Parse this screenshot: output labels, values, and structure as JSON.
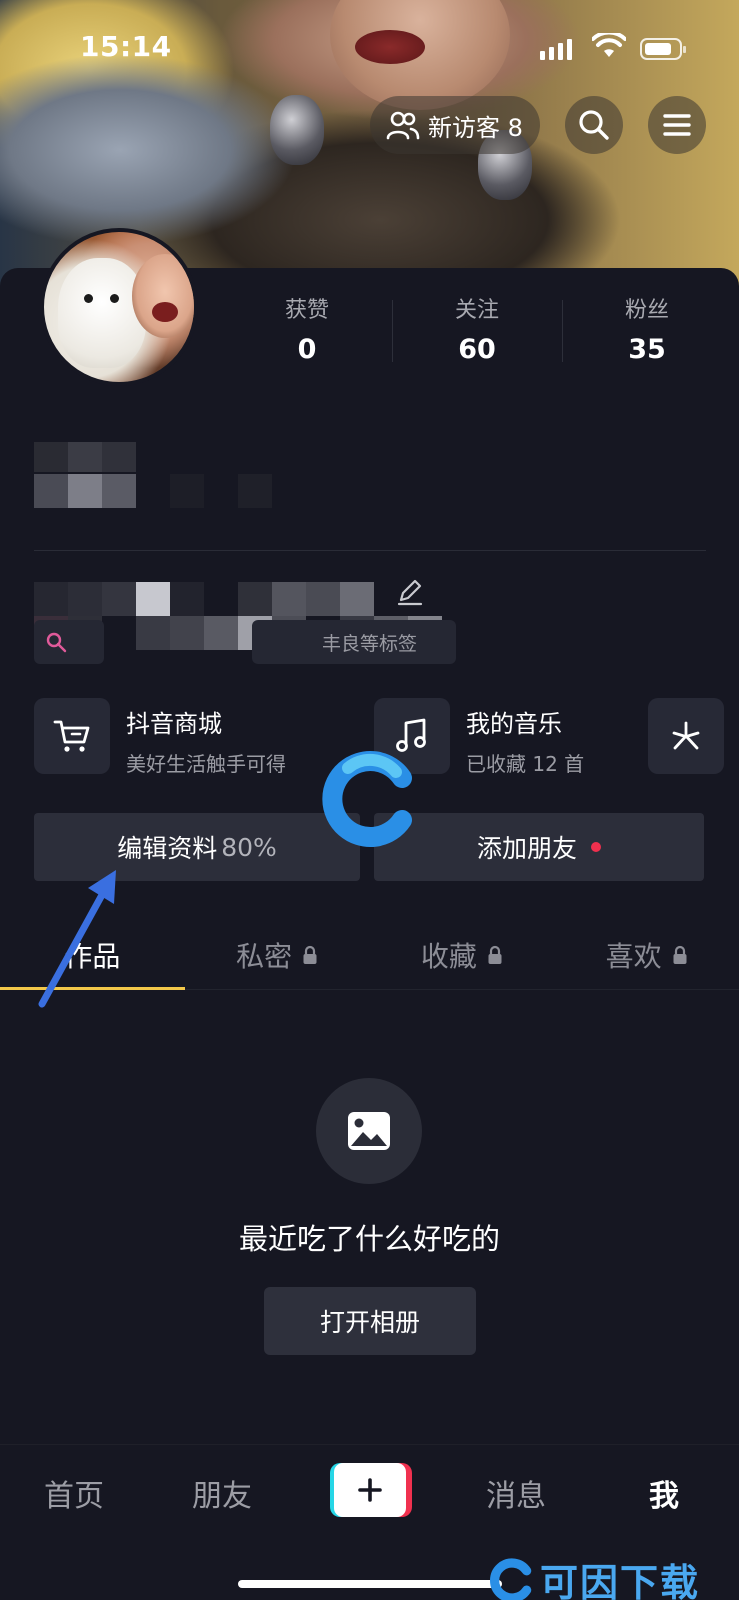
{
  "status_bar": {
    "time": "15:14"
  },
  "top_actions": {
    "visitors_label": "新访客 8",
    "search_icon": "search-icon",
    "menu_icon": "hamburger-menu-icon"
  },
  "stats": [
    {
      "label": "获赞",
      "value": "0"
    },
    {
      "label": "关注",
      "value": "60"
    },
    {
      "label": "粉丝",
      "value": "35"
    }
  ],
  "profile": {
    "tag_text": "丰良等标签"
  },
  "shortcuts": {
    "mall": {
      "title": "抖音商城",
      "subtitle": "美好生活触手可得",
      "icon": "cart-icon"
    },
    "music": {
      "title": "我的音乐",
      "subtitle": "已收藏 12 首",
      "icon": "music-note-icon"
    },
    "more_icon": "sparkle-icon"
  },
  "actions": {
    "edit_profile": "编辑资料",
    "edit_percent": "80%",
    "add_friends": "添加朋友"
  },
  "tabs": [
    {
      "label": "作品",
      "locked": false,
      "active": true
    },
    {
      "label": "私密",
      "locked": true,
      "active": false
    },
    {
      "label": "收藏",
      "locked": true,
      "active": false
    },
    {
      "label": "喜欢",
      "locked": true,
      "active": false
    }
  ],
  "empty_state": {
    "icon": "image-icon",
    "text": "最近吃了什么好吃的",
    "button": "打开相册"
  },
  "bottom_nav": {
    "home": "首页",
    "friends": "朋友",
    "create": "+",
    "messages": "消息",
    "me": "我"
  },
  "watermark": {
    "brand": "可因下载"
  },
  "colors": {
    "background": "#161722",
    "card": "#2c2e3a",
    "tab_indicator": "#f3c84a",
    "notification_dot": "#f0304e",
    "annotation_arrow": "#3a6fe0"
  }
}
